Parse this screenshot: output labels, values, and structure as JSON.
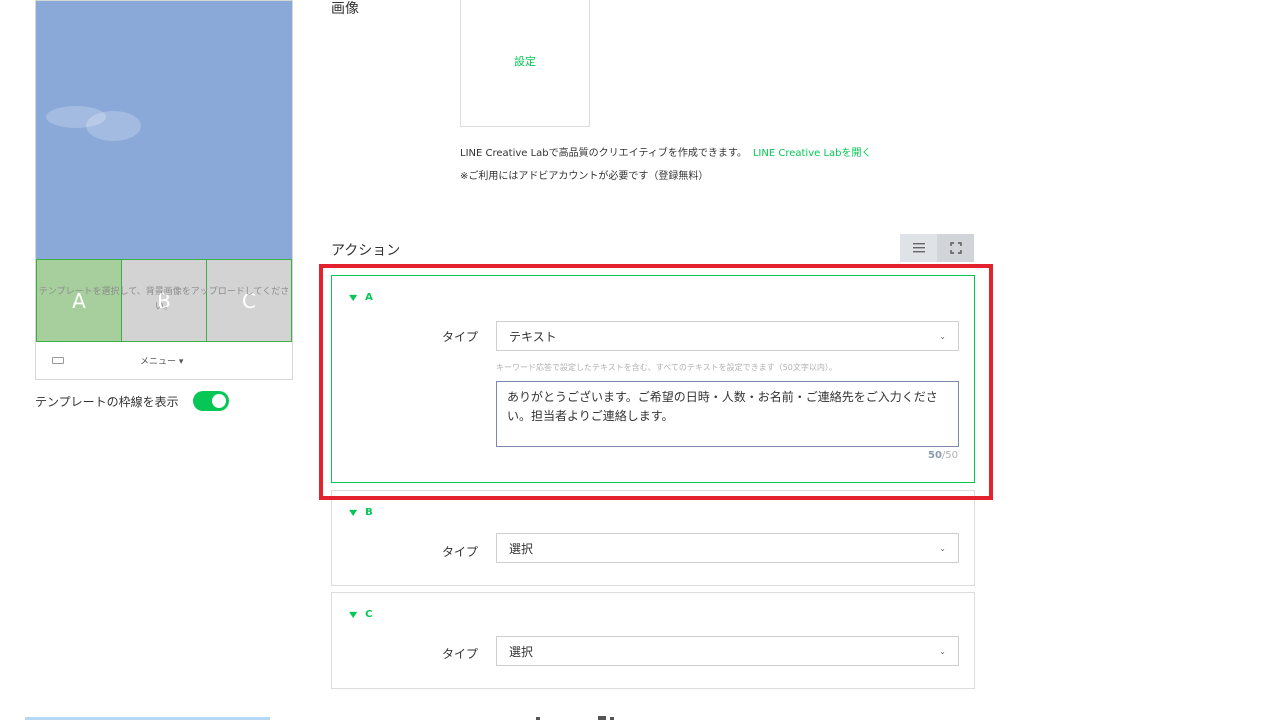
{
  "preview": {
    "cells": [
      {
        "letter": "A",
        "active": true
      },
      {
        "letter": "B",
        "active": false
      },
      {
        "letter": "C",
        "active": false
      }
    ],
    "overlay_text": "テンプレートを選択して、背景画像をアップロードしてください。",
    "menu_label": "メニュー ▾",
    "toggle_label": "テンプレートの枠線を表示",
    "toggle_on": true
  },
  "image_section": {
    "label": "画像",
    "set_label": "設定",
    "lab_text": "LINE Creative Labで高品質のクリエイティブを作成できます。",
    "lab_link": "LINE Creative Labを開く",
    "note": "※ご利用にはアドビアカウントが必要です（登録無料）"
  },
  "actions": {
    "title": "アクション",
    "view_icons": [
      "list-view-icon",
      "expand-view-icon"
    ],
    "items": [
      {
        "name": "A",
        "type_label": "タイプ",
        "type_value": "テキスト",
        "hint": "キーワード応答で設定したテキストを含む、すべてのテキストを設定できます（50文字以内）。",
        "text": "ありがとうございます。ご希望の日時・人数・お名前・ご連絡先をご入力ください。担当者よりご連絡します。",
        "count": "50",
        "max": "/50"
      },
      {
        "name": "B",
        "type_label": "タイプ",
        "type_value": "選択"
      },
      {
        "name": "C",
        "type_label": "タイプ",
        "type_value": "選択"
      }
    ]
  },
  "colors": {
    "accent": "#06c755",
    "highlight": "#e3222e",
    "photo_sky": "#8aa8d8"
  }
}
